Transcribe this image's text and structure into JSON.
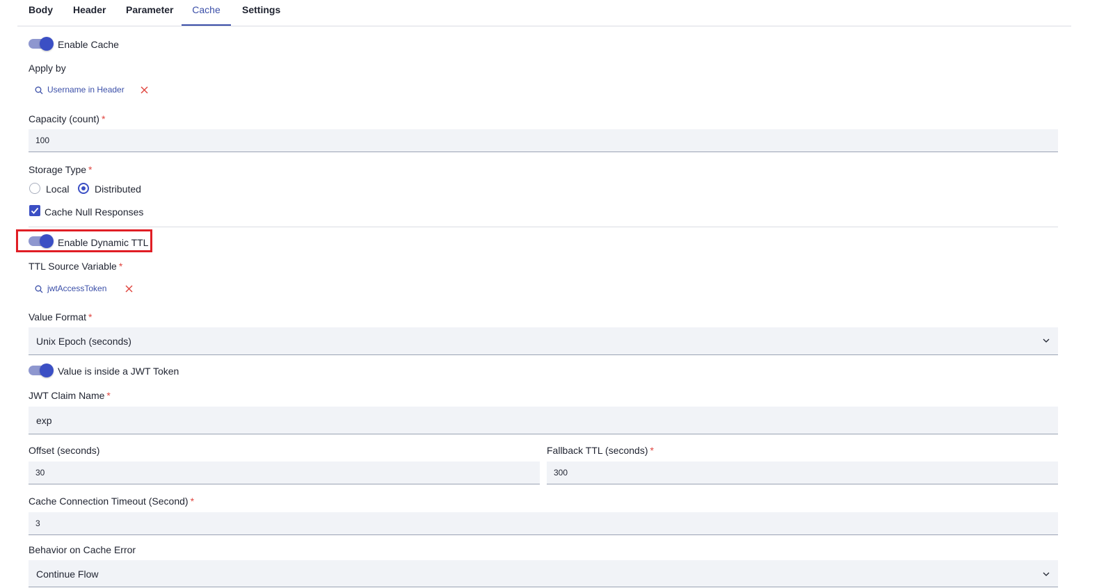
{
  "tabs": [
    {
      "label": "Body"
    },
    {
      "label": "Header"
    },
    {
      "label": "Parameter"
    },
    {
      "label": "Cache"
    },
    {
      "label": "Settings"
    }
  ],
  "active_tab": "Cache",
  "enable_cache": {
    "label": "Enable Cache",
    "on": true
  },
  "apply_by": {
    "label": "Apply by",
    "value": "Username in Header"
  },
  "capacity": {
    "label": "Capacity (count)",
    "required": "*",
    "value": "100"
  },
  "storage_type": {
    "label": "Storage Type",
    "required": "*",
    "options": [
      "Local",
      "Distributed"
    ],
    "selected": "Distributed"
  },
  "cache_null": {
    "label": "Cache Null Responses",
    "checked": true
  },
  "dynamic_ttl": {
    "label": "Enable Dynamic TTL",
    "on": true
  },
  "ttl_source": {
    "label": "TTL Source Variable",
    "required": "*",
    "value": "jwtAccessToken"
  },
  "value_format": {
    "label": "Value Format",
    "required": "*",
    "value": "Unix Epoch (seconds)"
  },
  "jwt_toggle": {
    "label": "Value is inside a JWT Token",
    "on": true
  },
  "jwt_claim": {
    "label": "JWT Claim Name",
    "required": "*",
    "value": "exp"
  },
  "offset": {
    "label": "Offset (seconds)",
    "value": "30"
  },
  "fallback_ttl": {
    "label": "Fallback TTL (seconds)",
    "required": "*",
    "value": "300"
  },
  "connection_timeout": {
    "label": "Cache Connection Timeout (Second)",
    "required": "*",
    "value": "3"
  },
  "cache_error": {
    "label": "Behavior on Cache Error",
    "value": "Continue Flow"
  },
  "colors": {
    "accent": "#3b4fc4",
    "required": "#e0453f",
    "highlight": "#e01e25",
    "field_bg": "#f1f3f7"
  }
}
